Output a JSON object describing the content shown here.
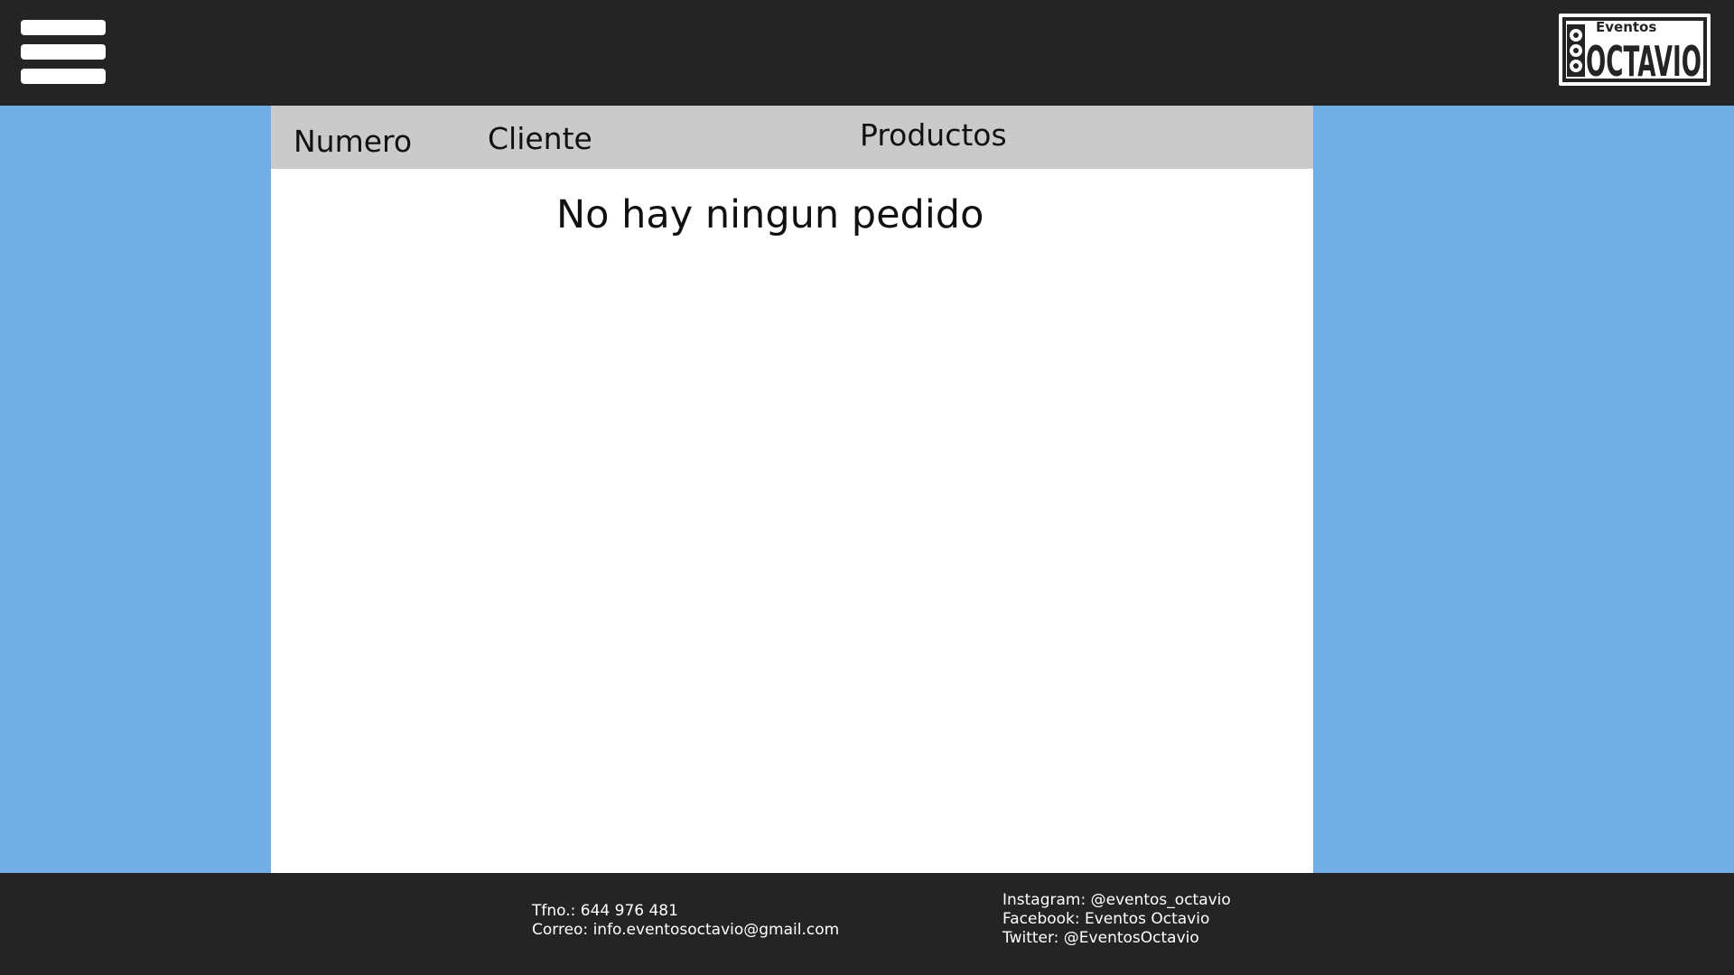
{
  "header": {
    "menu_icon": "hamburger-menu-icon",
    "logo": {
      "small_text": "Eventos",
      "big_text": "OCTAVIO"
    }
  },
  "orders_table": {
    "columns": [
      "Numero",
      "Cliente",
      "Productos"
    ],
    "empty_message": "No hay ningun pedido"
  },
  "footer": {
    "contact": {
      "phone": "Tfno.:  644 976 481",
      "email": "Correo: info.eventosoctavio@gmail.com"
    },
    "social": {
      "instagram": "Instagram: @eventos_octavio",
      "facebook": "Facebook: Eventos Octavio",
      "twitter": "Twitter: @EventosOctavio"
    }
  },
  "colors": {
    "topbar": "#242424",
    "background": "#72aee6",
    "table_header": "#cacaca",
    "panel": "#ffffff"
  }
}
